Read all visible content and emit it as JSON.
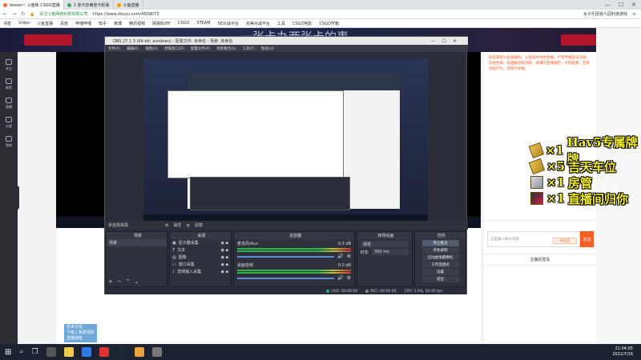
{
  "browser": {
    "tabs": [
      {
        "label": "lesson~ 斗鱼板 CSGO直播"
      },
      {
        "label": "1 张卡办两张卡的事"
      },
      {
        "label": "斗鱼直播"
      }
    ],
    "security_text": "武汉斗鱼网络科技有限公司",
    "url": "https://www.douyu.com/4609073",
    "right_text": "女子乐团丧人园利道游戏",
    "bookmarks": [
      "书签",
      "Video",
      "斗鱼直播",
      "百度",
      "哔哩哔哩",
      "知乎",
      "微博",
      "腾讯视频",
      "网易BUFF",
      "CSGO",
      "STEAM",
      "5E对战平台",
      "完美对战平台",
      "工具",
      "CSGO电影",
      "CSGO开箱"
    ]
  },
  "overlay_title": "一张卡办两张卡的事",
  "left_nav": [
    "关注",
    "推荐",
    "直播",
    "分类",
    "游戏"
  ],
  "obs": {
    "title": "OBS 27.1.3 (64-bit, windows) - 配置文件: 未命名 - 场景: 未命名",
    "menu": [
      "文件(F)",
      "编辑(E)",
      "视图(V)",
      "停靠窗口(D)",
      "配置文件(P)",
      "场景集合(S)",
      "工具(T)",
      "帮助(H)"
    ],
    "scenes_header": "场景",
    "scene_item": "场景",
    "sources_header": "来源",
    "sources": [
      "显示器采集",
      "文本",
      "图像",
      "窗口采集",
      "音频输入采集"
    ],
    "no_sources_text": "未选择来源",
    "props_label": "属性",
    "filters_label": "滤镜",
    "mixer_header": "混音器",
    "mixer_tracks": [
      {
        "name": "麦克风/Aux",
        "db": "0.0 dB"
      },
      {
        "name": "桌面音频",
        "db": "0.0 dB"
      }
    ],
    "transition_header": "转场动画",
    "transition_value": "渐变",
    "duration_label": "时长",
    "duration_value": "300 ms",
    "controls_header": "控件",
    "controls": [
      "停止推流",
      "开始录制",
      "启动虚拟摄像机",
      "工作室模式",
      "设置",
      "退出"
    ],
    "status": {
      "live": "LIVE: 00:00:00",
      "rec": "REC: 00:00:00",
      "cpu": "CPU: 1.0%, 60.00 fps"
    }
  },
  "gifts": [
    {
      "qty": "×1",
      "name": "Hav5专属牌牌"
    },
    {
      "qty": "×5",
      "name": "吉天车位"
    },
    {
      "qty": "×1",
      "name": "房管"
    },
    {
      "qty": "×1",
      "name": "直播间归你"
    }
  ],
  "chat": {
    "notice": "欢迎来到斗鱼直播间，斗鱼倡导绿色直播，严禁传播违法违规、低俗色情、吸烟酗酒等内容，请遵守直播规范，文明观看。若有违规行为，请及时举报。",
    "placeholder": "这里输入聊天内容",
    "send_label": "发送",
    "fans_label": "粉丝团",
    "section_title": "主播的发车"
  },
  "stream_overlay_lines": [
    "技术讨论",
    "下载 | 免费领取",
    "直播加班"
  ],
  "taskbar": {
    "time": "21:04:05",
    "date": "2022/7/16"
  },
  "colors": {
    "accent": "#ff5d23",
    "obs_bg": "#2b2e38",
    "gift_text": "#f4ee2a"
  }
}
